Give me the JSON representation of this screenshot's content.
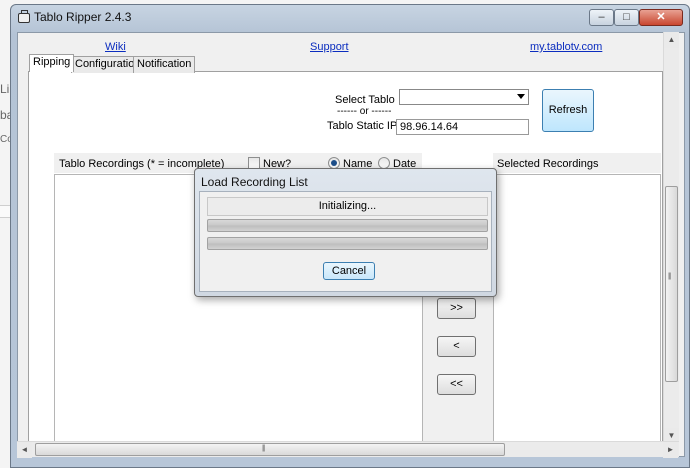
{
  "window": {
    "title": "Tablo Ripper 2.4.3",
    "minimize_glyph": "–",
    "maximize_glyph": "□",
    "close_glyph": "✕"
  },
  "links": {
    "wiki": "Wiki",
    "support": "Support",
    "site": "my.tablotv.com"
  },
  "tabs": [
    {
      "label": "Ripping",
      "active": true
    },
    {
      "label": "Configuration",
      "active": false
    },
    {
      "label": "Notification",
      "active": false
    }
  ],
  "form": {
    "select_tablo_label": "Select Tablo",
    "or_label": "------ or ------",
    "static_ip_label": "Tablo Static IP",
    "static_ip_value": "98.96.14.64",
    "refresh_label": "Refresh"
  },
  "recordings": {
    "header": "Tablo Recordings (* = incomplete)",
    "new_label": "New?",
    "new_checked": false,
    "sort_name_label": "Name",
    "sort_date_label": "Date",
    "sort_selected": "Name",
    "selected_header": "Selected Recordings"
  },
  "move_buttons": {
    "add_all": ">>",
    "remove": "<",
    "remove_all": "<<"
  },
  "dialog": {
    "title": "Load Recording List",
    "status": "Initializing...",
    "cancel_label": "Cancel"
  },
  "scroll": {
    "up_glyph": "▲",
    "down_glyph": "▼",
    "left_glyph": "◄",
    "right_glyph": "►",
    "grip_glyph": "|||"
  },
  "background_fragments": [
    "Li",
    "ba",
    "Co"
  ],
  "colors": {
    "link": "#0b2dbf",
    "accent_button": "#bee6fd",
    "radio_dot": "#1c4e8a"
  }
}
